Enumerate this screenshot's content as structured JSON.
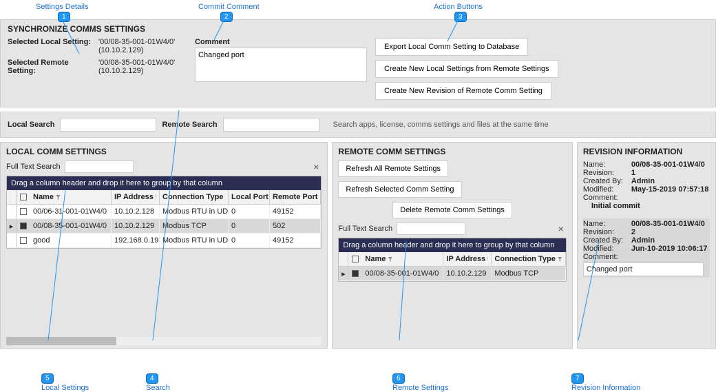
{
  "callouts": {
    "c1": "Settings Details",
    "c2": "Commit Comment",
    "c3": "Action Buttons",
    "c4": "Search",
    "c5": "Local Settings",
    "c6": "Remote Settings",
    "c7": "Revision Information"
  },
  "sync": {
    "title": "SYNCHRONIZE COMMS SETTINGS",
    "selected_local_label": "Selected Local Setting:",
    "selected_local_value": "'00/08-35-001-01W4/0' (10.10.2.129)",
    "selected_remote_label": "Selected Remote Setting:",
    "selected_remote_value": "'00/08-35-001-01W4/0' (10.10.2.129)"
  },
  "comment": {
    "label": "Comment",
    "value": "Changed port"
  },
  "action_buttons": {
    "export": "Export Local Comm Setting to Database",
    "create_new_local": "Create New Local Settings from Remote Settings",
    "create_new_rev": "Create New Revision of Remote Comm Setting"
  },
  "search": {
    "local_label": "Local Search",
    "remote_label": "Remote Search",
    "hint": "Search apps, license, comms settings and files at the same time"
  },
  "local": {
    "title": "LOCAL COMM SETTINGS",
    "ftsearch_label": "Full Text Search",
    "group_hint": "Drag a column header and drop it here to group by that column",
    "cols": {
      "name": "Name",
      "ip": "IP Address",
      "ctype": "Connection Type",
      "lport": "Local Port",
      "rport": "Remote Port"
    },
    "rows": [
      {
        "name": "00/06-31-001-01W4/0",
        "ip": "10.10.2.128",
        "ctype": "Modbus RTU in UDP",
        "lport": "0",
        "rport": "49152",
        "selected": false
      },
      {
        "name": "00/08-35-001-01W4/0",
        "ip": "10.10.2.129",
        "ctype": "Modbus TCP",
        "lport": "0",
        "rport": "502",
        "selected": true
      },
      {
        "name": "good",
        "ip": "192.168.0.19",
        "ctype": "Modbus RTU in UDP",
        "lport": "0",
        "rport": "49152",
        "selected": false
      }
    ]
  },
  "remote": {
    "title": "REMOTE COMM SETTINGS",
    "refresh_all": "Refresh All Remote Settings",
    "refresh_sel": "Refresh Selected Comm Setting",
    "delete": "Delete Remote Comm Settings",
    "ftsearch_label": "Full Text Search",
    "group_hint": "Drag a column header and drop it here to group by that column",
    "cols": {
      "name": "Name",
      "ip": "IP Address",
      "ctype": "Connection Type"
    },
    "rows": [
      {
        "name": "00/08-35-001-01W4/0",
        "ip": "10.10.2.129",
        "ctype": "Modbus TCP",
        "selected": true
      }
    ]
  },
  "revision": {
    "title": "REVISION INFORMATION",
    "labels": {
      "name": "Name:",
      "rev": "Revision:",
      "created": "Created By:",
      "modified": "Modified:",
      "comment": "Comment:"
    },
    "items": [
      {
        "name": "00/08-35-001-01W4/0",
        "rev": "1",
        "created": "Admin",
        "modified": "May-15-2019 07:57:18",
        "comment": "Initial commit",
        "selected": false
      },
      {
        "name": "00/08-35-001-01W4/0",
        "rev": "2",
        "created": "Admin",
        "modified": "Jun-10-2019 10:06:17",
        "comment": "Changed port",
        "selected": true
      }
    ]
  }
}
